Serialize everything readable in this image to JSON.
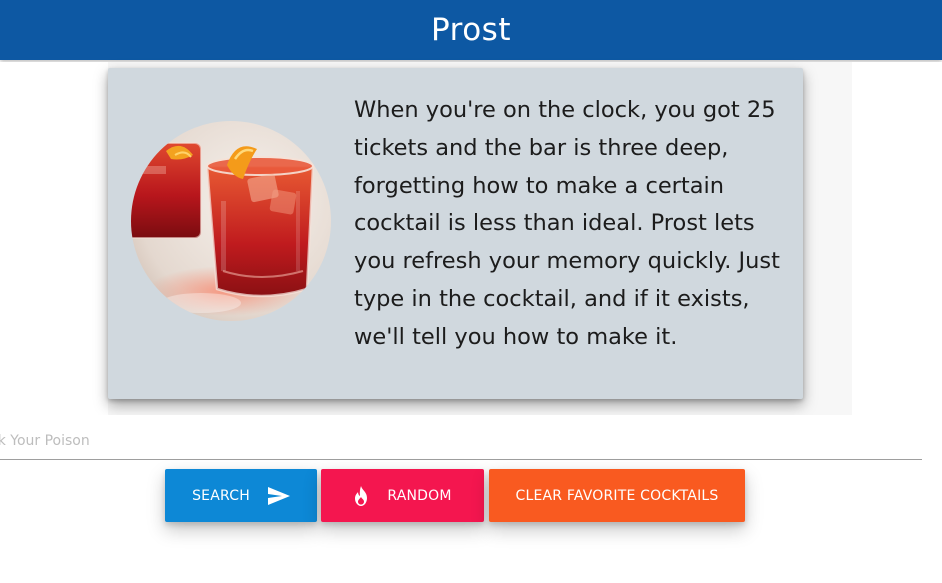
{
  "header": {
    "title": "Prost"
  },
  "intro": {
    "image_alt": "cocktail-glasses-photo",
    "text": "When you're on the clock, you got 25 tickets and the bar is three deep, forgetting how to make a certain cocktail is less than ideal. Prost lets you refresh your memory quickly. Just type in the cocktail, and if it exists, we'll tell you how to make it."
  },
  "search": {
    "placeholder": "Pick Your Poison",
    "value": ""
  },
  "buttons": {
    "search_label": "SEARCH",
    "search_icon": "send-icon",
    "random_label": "RANDOM",
    "random_icon": "fire-icon",
    "clear_label": "CLEAR FAVORITE COCKTAILS"
  },
  "colors": {
    "header": "#0d58a3",
    "card": "#d0d8de",
    "search_button": "#0d88d6",
    "random_button": "#f4164f",
    "clear_button": "#f95a20"
  }
}
